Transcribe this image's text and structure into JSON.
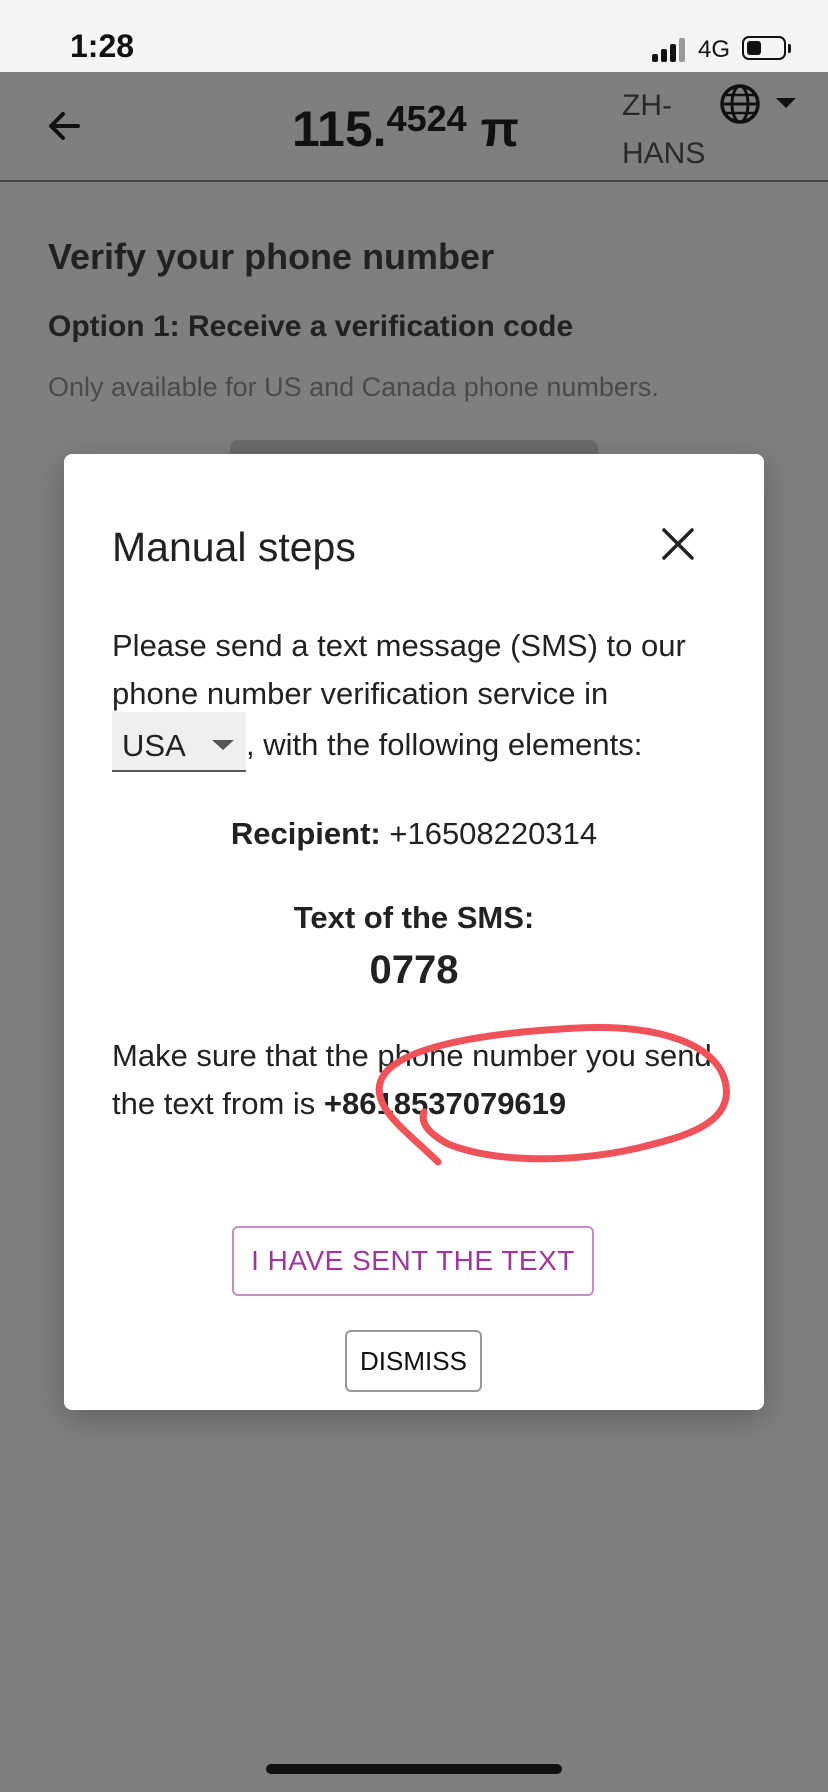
{
  "status_bar": {
    "time": "1:28",
    "network": "4G"
  },
  "header": {
    "balance_main": "115.",
    "balance_decimal": "4524",
    "currency_symbol": "π",
    "language": "ZH-HANS"
  },
  "page": {
    "title": "Verify your phone number",
    "option1_title": "Option 1: Receive a verification code",
    "option1_note": "Only available for US and Canada phone numbers."
  },
  "modal": {
    "title": "Manual steps",
    "intro": "Please send a text message (SMS) to our phone number verification service in",
    "country_selected": "USA",
    "intro_suffix": ", with the following elements:",
    "recipient_label": "Recipient:",
    "recipient_number": "+16508220314",
    "sms_label": "Text of the SMS:",
    "sms_code": "0778",
    "notice_text": "Make sure that the phone number you send the text from is",
    "sender_number": "+8618537079619",
    "sent_button": "I HAVE SENT THE TEXT",
    "dismiss_button": "DISMISS"
  },
  "colors": {
    "accent_button": "#a0359c",
    "annotation": "#f0525a",
    "overlay": "#7f7f7f"
  }
}
